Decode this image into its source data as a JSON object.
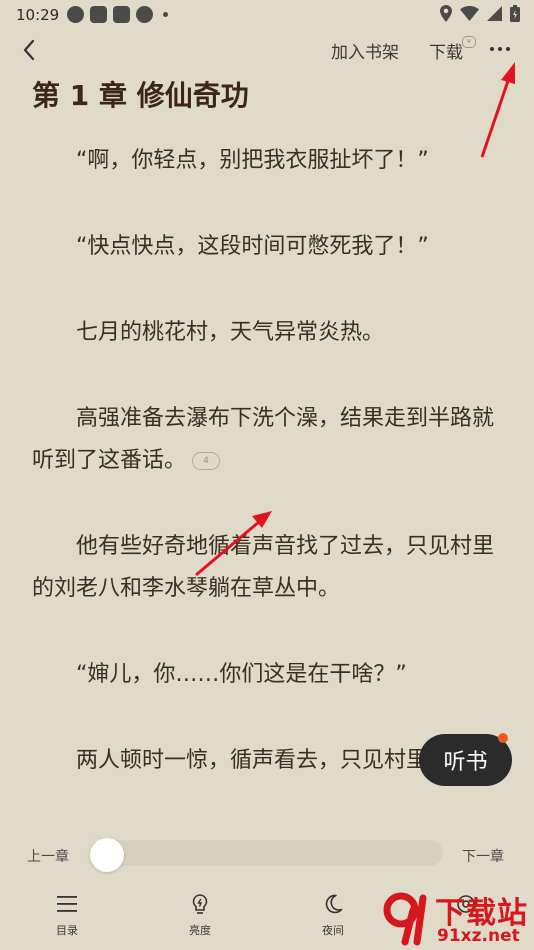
{
  "status_bar": {
    "time": "10:29"
  },
  "topbar": {
    "add_to_shelf": "加入书架",
    "download": "下载"
  },
  "chapter": {
    "title": "第 1 章 修仙奇功",
    "paragraphs": [
      "“啊，你轻点，别把我衣服扯坏了！”",
      "“快点快点，这段时间可憋死我了！”",
      "七月的桃花村，天气异常炎热。",
      "高强准备去瀑布下洗个澡，结果走到半路就听到了这番话。",
      "他有些好奇地循着声音找了过去，只见村里的刘老八和李水琴躺在草丛中。",
      "“婶儿，你……你们这是在干啥？”",
      "两人顿时一惊，循声看去，只见村里"
    ],
    "comment_count": "4"
  },
  "listen_button": {
    "label": "听书"
  },
  "progress": {
    "prev_label": "上一章",
    "next_label": "下一章",
    "value": 0
  },
  "bottom_nav": [
    {
      "label": "目录",
      "icon": "list-icon"
    },
    {
      "label": "亮度",
      "icon": "bulb-icon"
    },
    {
      "label": "夜间",
      "icon": "moon-icon"
    }
  ],
  "watermark": {
    "title": "下载站",
    "url": "91xz.net"
  },
  "colors": {
    "background": "#e0dbc8",
    "listen_bg": "#2b2b2b",
    "badge": "#f25a1b",
    "arrow": "#e0141e"
  }
}
